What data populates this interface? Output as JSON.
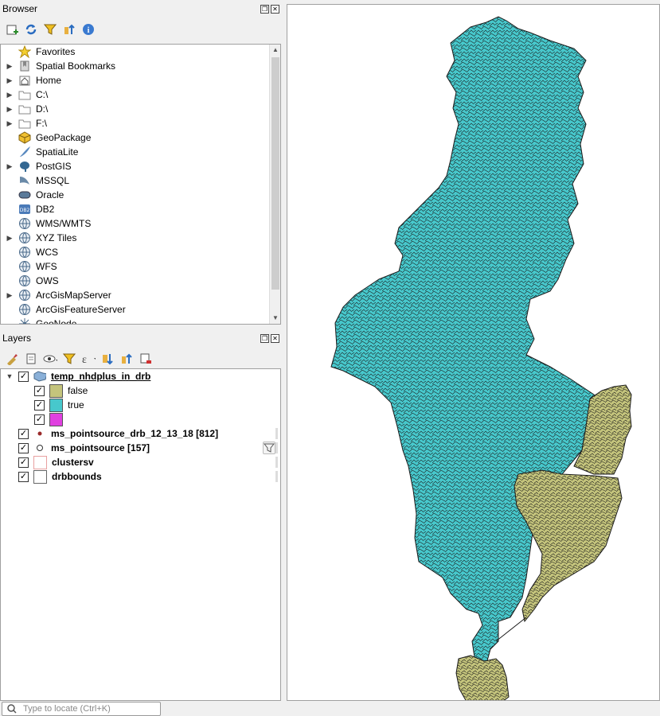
{
  "browser": {
    "title": "Browser",
    "items": [
      {
        "label": "Favorites",
        "icon": "star-icon",
        "expandable": false
      },
      {
        "label": "Spatial Bookmarks",
        "icon": "bookmark-icon",
        "expandable": true
      },
      {
        "label": "Home",
        "icon": "home-icon",
        "expandable": true
      },
      {
        "label": "C:\\",
        "icon": "folder-icon",
        "expandable": true
      },
      {
        "label": "D:\\",
        "icon": "folder-icon",
        "expandable": true
      },
      {
        "label": "F:\\",
        "icon": "folder-icon",
        "expandable": true
      },
      {
        "label": "GeoPackage",
        "icon": "geopackage-icon",
        "expandable": false
      },
      {
        "label": "SpatiaLite",
        "icon": "feather-icon",
        "expandable": false
      },
      {
        "label": "PostGIS",
        "icon": "elephant-icon",
        "expandable": true
      },
      {
        "label": "MSSQL",
        "icon": "mssql-icon",
        "expandable": false
      },
      {
        "label": "Oracle",
        "icon": "oracle-icon",
        "expandable": false
      },
      {
        "label": "DB2",
        "icon": "db2-icon",
        "expandable": false
      },
      {
        "label": "WMS/WMTS",
        "icon": "globe-icon",
        "expandable": false
      },
      {
        "label": "XYZ Tiles",
        "icon": "globe-icon",
        "expandable": true
      },
      {
        "label": "WCS",
        "icon": "globe-icon",
        "expandable": false
      },
      {
        "label": "WFS",
        "icon": "globe-icon",
        "expandable": false
      },
      {
        "label": "OWS",
        "icon": "globe-icon",
        "expandable": false
      },
      {
        "label": "ArcGisMapServer",
        "icon": "globe-icon",
        "expandable": true
      },
      {
        "label": "ArcGisFeatureServer",
        "icon": "globe-icon",
        "expandable": false
      },
      {
        "label": "GeoNode",
        "icon": "geonode-icon",
        "expandable": false
      }
    ]
  },
  "layers": {
    "title": "Layers",
    "items": [
      {
        "label": "temp_nhdplus_in_drb",
        "checked": true,
        "bold": true,
        "underline": true,
        "expanded": true,
        "symbol": "polygon-layer-icon"
      },
      {
        "label": "false",
        "checked": true,
        "swatch": "#c4c47c",
        "child": true
      },
      {
        "label": "true",
        "checked": true,
        "swatch": "#47c8cc",
        "child": true
      },
      {
        "label": "",
        "checked": true,
        "swatch": "#e040e0",
        "child": true
      },
      {
        "label": "ms_pointsource_drb_12_13_18 [812]",
        "checked": true,
        "bold": true,
        "symbol": "dot-icon"
      },
      {
        "label": "ms_pointsource [157]",
        "checked": true,
        "bold": true,
        "symbol": "circle-icon",
        "filter": true
      },
      {
        "label": "clustersv",
        "checked": true,
        "bold": true,
        "outline": "#e8a0a0"
      },
      {
        "label": "drbbounds",
        "checked": true,
        "bold": true,
        "outline": "#666666"
      }
    ]
  },
  "locator": {
    "placeholder": "Type to locate (Ctrl+K)"
  },
  "colors": {
    "basin_true": "#47c8cc",
    "basin_false": "#c4c47c",
    "outline": "#1a1a1a"
  }
}
